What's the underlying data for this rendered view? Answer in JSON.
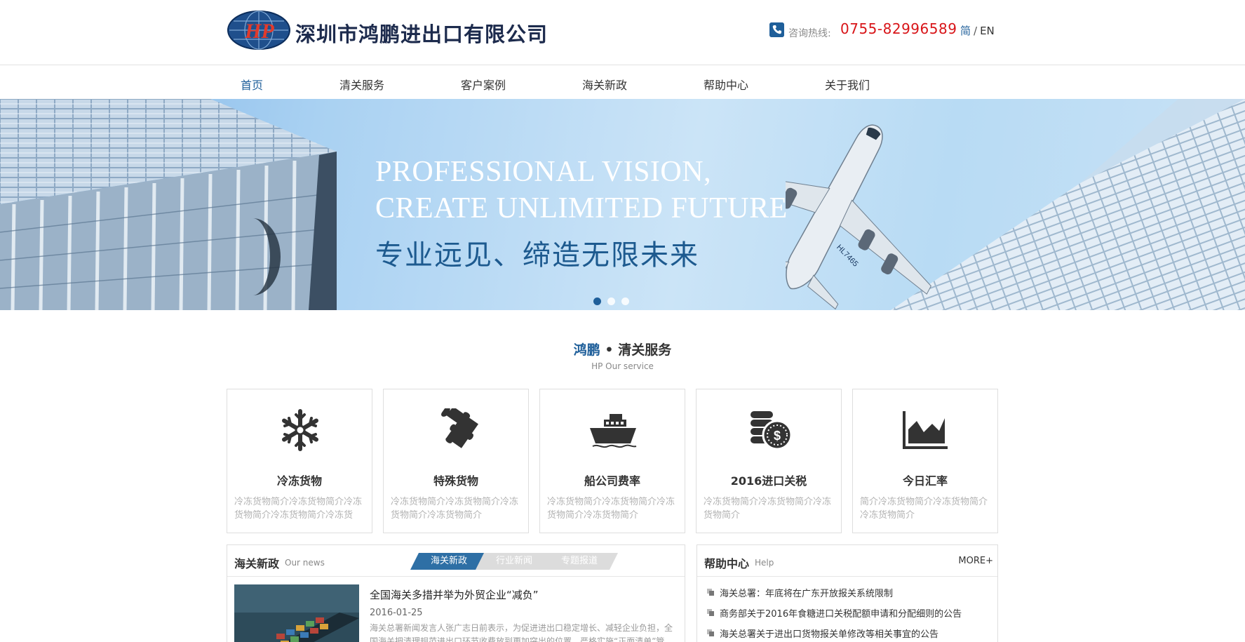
{
  "header": {
    "company_name": "深圳市鸿鹏进出口有限公司",
    "logo_letters": "HP",
    "phone_label": "咨询热线:",
    "phone_number": "0755-82996589",
    "lang_cn": "简",
    "lang_sep": "/",
    "lang_en": "EN"
  },
  "nav": {
    "items": [
      {
        "label": "首页",
        "active": true
      },
      {
        "label": "清关服务"
      },
      {
        "label": "客户案例"
      },
      {
        "label": "海关新政"
      },
      {
        "label": "帮助中心"
      },
      {
        "label": "关于我们"
      }
    ]
  },
  "banner": {
    "en_line1": "PROFESSIONAL VISION,",
    "en_line2": "CREATE UNLIMITED FUTURE",
    "cn_line": "专业远见、缔造无限未来",
    "plane_reg": "HL7465",
    "slides": 3,
    "active_slide": 1
  },
  "services": {
    "title_brand": "鸿鹏",
    "title_dot": " • ",
    "title_main": "清关服务",
    "subtitle": "HP Our service",
    "cards": [
      {
        "title": "冷冻货物",
        "desc": "冷冻货物简介冷冻货物简介冷冻货物简介冷冻货物简介冷冻货",
        "icon": "snowflake-icon"
      },
      {
        "title": "特殊货物",
        "desc": "冷冻货物简介冷冻货物简介冷冻货物简介冷冻货物简介",
        "icon": "puzzle-icon"
      },
      {
        "title": "船公司费率",
        "desc": "冷冻货物简介冷冻货物简介冷冻货物简介冷冻货物简介",
        "icon": "ship-icon"
      },
      {
        "title": "2016进口关税",
        "desc": "冷冻货物简介冷冻货物简介冷冻货物简介",
        "icon": "coins-icon"
      },
      {
        "title": "今日汇率",
        "desc": "简介冷冻货物简介冷冻货物简介冷冻货物简介",
        "icon": "area-chart-icon"
      }
    ]
  },
  "news": {
    "title": "海关新政",
    "title_en": "Our news",
    "tabs": [
      "海关新政",
      "行业新闻",
      "专题报道"
    ],
    "headline": "全国海关多措并举为外贸企业“减负”",
    "date": "2016-01-25",
    "body": "海关总署新闻发言人张广志日前表示，为促进进出口稳定增长、减轻企业负担，全国海关把清理规范进出口环节收费放到更加突出的位置，严格实施“正面清单”管"
  },
  "help": {
    "title": "帮助中心",
    "title_en": "Help",
    "more": "MORE+",
    "items": [
      "海关总署：年底将在广东开放报关系统限制",
      "商务部关于2016年食糖进口关税配额申请和分配细则的公告",
      "海关总署关于进出口货物报关单修改等相关事宜的公告"
    ]
  },
  "colors": {
    "brand_blue": "#1f5f9a",
    "phone_red": "#d81418",
    "tab_active": "#2e6fa5",
    "tab_inactive": "#dcdcdc"
  }
}
